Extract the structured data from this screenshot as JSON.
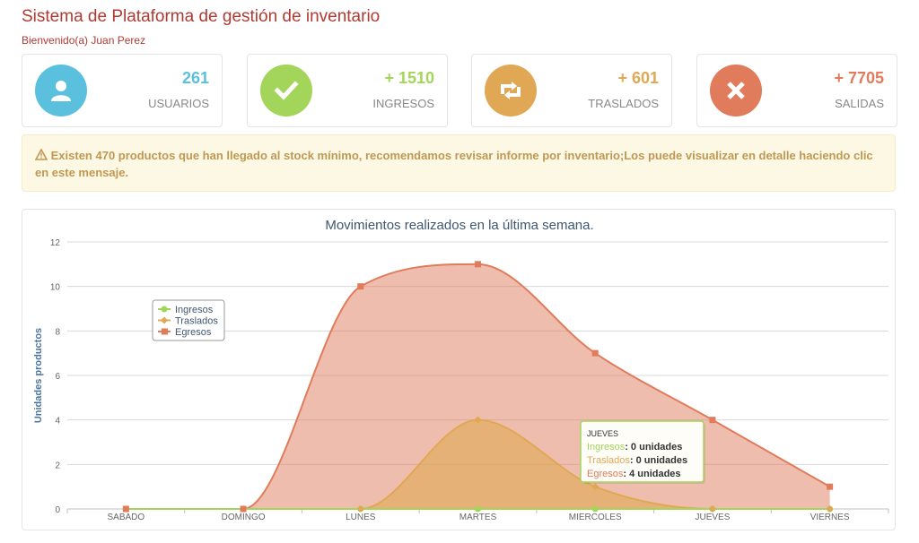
{
  "header": {
    "title": "Sistema de Plataforma de gestión de inventario",
    "welcome": "Bienvenido(a) Juan Perez"
  },
  "stats": [
    {
      "value": "261",
      "label": "USUARIOS",
      "color": "#5bc0de",
      "icon": "user-icon"
    },
    {
      "value": "+ 1510",
      "label": "INGRESOS",
      "color": "#a3d55a",
      "icon": "check-icon"
    },
    {
      "value": "+ 601",
      "label": "TRASLADOS",
      "color": "#e0a854",
      "icon": "retweet-icon"
    },
    {
      "value": "+ 7705",
      "label": "SALIDAS",
      "color": "#e07b5b",
      "icon": "close-icon"
    }
  ],
  "alert": {
    "icon": "warning-icon",
    "text": "Existen 470 productos que han llegado al stock mínimo, recomendamos revisar informe por inventario;Los puede visualizar en detalle haciendo clic en este mensaje."
  },
  "chart_data": {
    "type": "area",
    "title": "Movimientos realizados en la última semana.",
    "ylabel": "Unidades productos",
    "xlabel": "",
    "categories": [
      "SABADO",
      "DOMINGO",
      "LUNES",
      "MARTES",
      "MIERCOLES",
      "JUEVES",
      "VIERNES"
    ],
    "ylim": [
      0,
      12
    ],
    "yticks": [
      "0",
      "2",
      "4",
      "6",
      "8",
      "10",
      "12"
    ],
    "grid": true,
    "legend_position": "top-left",
    "series": [
      {
        "name": "Ingresos",
        "color": "#a3d55a",
        "values": [
          0,
          0,
          0,
          0,
          0,
          0,
          0
        ]
      },
      {
        "name": "Traslados",
        "color": "#e0a854",
        "values": [
          0,
          0,
          0,
          4,
          1,
          0,
          0
        ]
      },
      {
        "name": "Egresos",
        "color": "#e07b5b",
        "values": [
          0,
          0,
          10,
          11,
          7,
          4,
          1
        ]
      }
    ],
    "tooltip": {
      "title": "JUEVES",
      "rows": [
        {
          "name": "Ingresos",
          "value": "0 unidades"
        },
        {
          "name": "Traslados",
          "value": "0 unidades"
        },
        {
          "name": "Egresos",
          "value": "4 unidades"
        }
      ]
    }
  }
}
